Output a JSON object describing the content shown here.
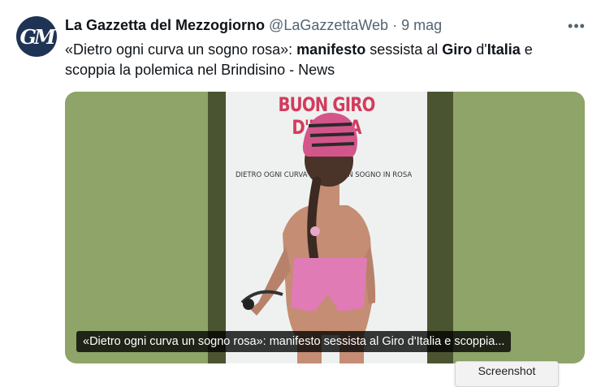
{
  "tweet": {
    "author_avatar_initials": "GM",
    "author_name": "La Gazzetta del Mezzogiorno",
    "author_handle": "@LaGazzettaWeb",
    "separator": "·",
    "date": "9 mag",
    "more_icon": "more-horizontal-icon",
    "text_segments": [
      {
        "text": "«Dietro ogni curva un sogno rosa»: ",
        "bold": false
      },
      {
        "text": "manifesto",
        "bold": true
      },
      {
        "text": " sessista al ",
        "bold": false
      },
      {
        "text": "Giro",
        "bold": true
      },
      {
        "text": " d'",
        "bold": false
      },
      {
        "text": "Italia",
        "bold": true
      },
      {
        "text": " e scoppia la polemica nel Brindisino - News",
        "bold": false
      }
    ]
  },
  "media": {
    "poster_title": "BUON GIRO D'ITALIA",
    "poster_sub_left": "DIETRO OGNI CURVA",
    "poster_sub_right": "UN SOGNO IN ROSA",
    "caption": "«Dietro ogni curva un sogno rosa»: manifesto sessista al Giro d'Italia e scoppia...",
    "colors": {
      "background": "#8ea468",
      "poster": "#eef1f0",
      "title": "#d23c5c",
      "helmet": "#d4558a",
      "shorts": "#e07bb6"
    }
  },
  "overlay": {
    "screenshot_label": "Screenshot"
  }
}
